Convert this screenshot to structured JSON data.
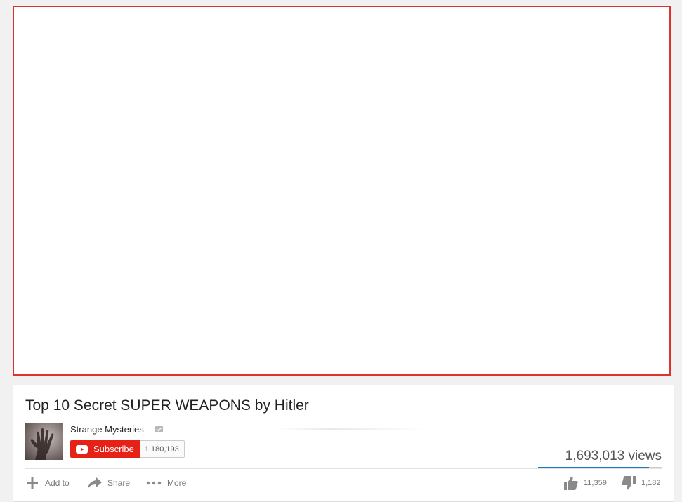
{
  "video": {
    "title": "Top 10 Secret SUPER WEAPONS by Hitler",
    "views": "1,693,013 views"
  },
  "channel": {
    "name": "Strange Mysteries",
    "subscribe_label": "Subscribe",
    "subscriber_count": "1,180,193"
  },
  "actions": {
    "add_to": "Add to",
    "share": "Share",
    "more": "More"
  },
  "ratings": {
    "likes": "11,359",
    "dislikes": "1,182",
    "like_fraction": 0.9
  },
  "colors": {
    "player_border": "#e03131",
    "subscribe_red": "#e62117",
    "like_bar_blue": "#167ac6"
  },
  "icons": [
    "verified-icon",
    "youtube-play-icon",
    "add-icon",
    "share-icon",
    "more-icon",
    "thumbs-up-icon",
    "thumbs-down-icon"
  ]
}
